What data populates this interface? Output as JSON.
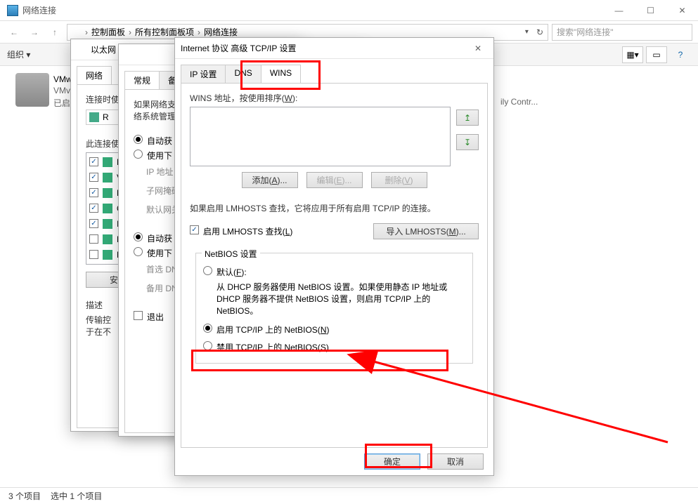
{
  "window": {
    "title": "网络连接",
    "breadcrumb": {
      "root": "控制面板",
      "level1": "所有控制面板项",
      "level2": "网络连接"
    },
    "search_placeholder": "搜索\"网络连接\"",
    "organize_label": "组织 ▾"
  },
  "items": {
    "left_title": "VMw",
    "left_sub1": "VMv",
    "left_sub2": "已启",
    "right_sub": "ily Contr..."
  },
  "statusbar": {
    "count": "3 个项目",
    "selected": "选中 1 个项目"
  },
  "dialog1": {
    "title": "以太网",
    "tabs": {
      "network": "网络"
    },
    "connect_label": "连接时使",
    "adapter_short": "R",
    "this_uses": "此连接使",
    "install": "安",
    "desc": "描述",
    "desc_text1": "传输控",
    "desc_text2": "于在不"
  },
  "dialog2": {
    "tabs": {
      "general": "常规",
      "backup": "备用"
    },
    "para1_a": "如果网络支",
    "para1_b": "络系统管理",
    "radio_auto_ip": "自动获",
    "radio_use_ip": "使用下",
    "label_ip": "IP 地址",
    "label_subnet": "子网掩码",
    "label_gateway": "默认网关",
    "radio_auto_dns": "自动获",
    "radio_use_dns": "使用下",
    "label_pref_dns": "首选 DN",
    "label_alt_dns": "备用 DN",
    "exit_check": "退出"
  },
  "dialog3": {
    "title": "Internet 协议 高级 TCP/IP 设置",
    "tabs": {
      "ip": "IP 设置",
      "dns": "DNS",
      "wins": "WINS"
    },
    "wins_label_prefix": "WINS 地址，按使用排序(",
    "wins_label_u": "W",
    "wins_label_suffix": "):",
    "btn_add_prefix": "添加(",
    "btn_add_u": "A",
    "btn_add_suffix": ")...",
    "btn_edit_prefix": "编辑(",
    "btn_edit_u": "E",
    "btn_edit_suffix": ")...",
    "btn_del_prefix": "删除(",
    "btn_del_u": "V",
    "btn_del_suffix": ")",
    "lmhosts_note": "如果启用 LMHOSTS 查找，它将应用于所有启用 TCP/IP 的连接。",
    "cb_lmhosts_prefix": "启用 LMHOSTS 查找(",
    "cb_lmhosts_u": "L",
    "cb_lmhosts_suffix": ")",
    "btn_import_prefix": "导入 LMHOSTS(",
    "btn_import_u": "M",
    "btn_import_suffix": ")...",
    "netbios_group": "NetBIOS 设置",
    "radio_default_prefix": "默认(",
    "radio_default_u": "F",
    "radio_default_suffix": "):",
    "default_desc": "从 DHCP 服务器使用 NetBIOS 设置。如果使用静态 IP 地址或 DHCP 服务器不提供 NetBIOS 设置，则启用 TCP/IP 上的 NetBIOS。",
    "radio_enable_prefix": "启用 TCP/IP 上的 NetBIOS(",
    "radio_enable_u": "N",
    "radio_enable_suffix": ")",
    "radio_disable_prefix": "禁用 TCP/IP 上的 NetBIOS(",
    "radio_disable_u": "S",
    "radio_disable_suffix": ")",
    "btn_ok": "确定",
    "btn_cancel": "取消"
  }
}
